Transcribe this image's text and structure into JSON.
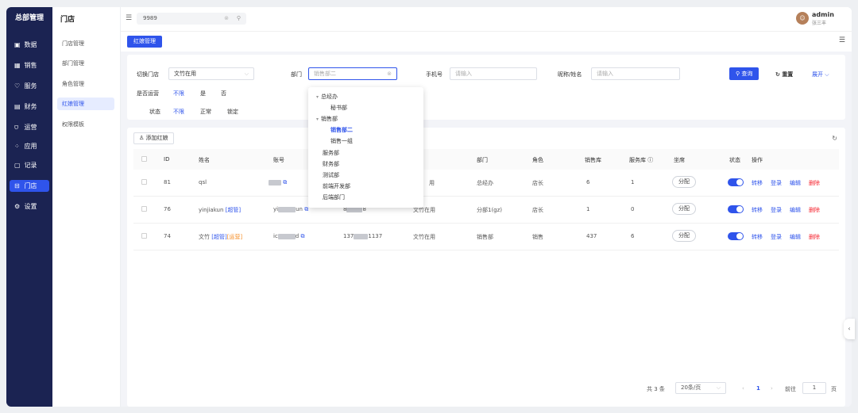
{
  "sidebar": {
    "title": "总部管理",
    "items": [
      {
        "icon": "▣",
        "label": "数据"
      },
      {
        "icon": "▦",
        "label": "销售"
      },
      {
        "icon": "♡",
        "label": "服务"
      },
      {
        "icon": "▤",
        "label": "财务"
      },
      {
        "icon": "⩌",
        "label": "运营"
      },
      {
        "icon": "⁘",
        "label": "应用"
      },
      {
        "icon": "▢",
        "label": "记录"
      },
      {
        "icon": "⊟",
        "label": "门店"
      },
      {
        "icon": "⚙",
        "label": "设置"
      }
    ]
  },
  "submenu": {
    "title": "门店",
    "items": [
      "门店管理",
      "部门管理",
      "角色管理",
      "红娘管理",
      "权限模板"
    ]
  },
  "topbar": {
    "search_value": "9989",
    "user_name": "admin",
    "user_sub": "张三丰"
  },
  "tab": {
    "label": "红娘管理"
  },
  "filter": {
    "store_label": "切换门店",
    "store_value": "文竹在用",
    "dept_label": "部门",
    "dept_placeholder": "销售部二",
    "phone_label": "手机号",
    "phone_placeholder": "请输入",
    "nick_label": "昵称/姓名",
    "nick_placeholder": "请输入",
    "search_btn": "查询",
    "reset_btn": "重置",
    "expand_link": "展开",
    "ops_label": "是否运营",
    "ops_options": [
      "不限",
      "是",
      "否"
    ],
    "status_label": "状态",
    "status_options": [
      "不限",
      "正常",
      "锁定"
    ]
  },
  "dept_tree": [
    {
      "label": "总经办",
      "level": 0,
      "caret": true
    },
    {
      "label": "秘书部",
      "level": 1
    },
    {
      "label": "销售部",
      "level": 0,
      "caret": true
    },
    {
      "label": "销售部二",
      "level": 1,
      "selected": true
    },
    {
      "label": "销售一组",
      "level": 1
    },
    {
      "label": "服务部",
      "level": 0
    },
    {
      "label": "财务部",
      "level": 0
    },
    {
      "label": "测试部",
      "level": 0
    },
    {
      "label": "前端开发部",
      "level": 0
    },
    {
      "label": "后端部门",
      "level": 0
    }
  ],
  "table": {
    "add_btn": "添加红娘",
    "columns": {
      "id": "ID",
      "name": "姓名",
      "account": "账号",
      "dept": "部门",
      "role": "角色",
      "sales": "销售库",
      "service": "服务库",
      "seat": "坐席",
      "status": "状态",
      "ops": "操作"
    },
    "rows": [
      {
        "id": "81",
        "name": "qsl",
        "tag1": "",
        "tag2": "",
        "account_a": "",
        "account_b": "",
        "phone_a": "",
        "phone_b": "",
        "store": "用",
        "dept": "总经办",
        "role": "店长",
        "sales": "6",
        "service": "1"
      },
      {
        "id": "76",
        "name": "yinjiakun",
        "tag1": "[超管]",
        "tag2": "",
        "account_a": "yi",
        "account_b": "un",
        "phone_a": "8",
        "phone_b": "8",
        "store": "文竹在用",
        "dept": "分部1(gz)",
        "role": "店长",
        "sales": "1",
        "service": "0"
      },
      {
        "id": "74",
        "name": "文竹",
        "tag1": "[超管]",
        "tag2": "[运营]",
        "account_a": "ic",
        "account_b": "d",
        "phone_a": "137",
        "phone_b": "1137",
        "store": "文竹在用",
        "dept": "销售部",
        "role": "销售",
        "sales": "437",
        "service": "6"
      }
    ],
    "assign_label": "分配",
    "action_labels": [
      "转移",
      "登录",
      "编辑",
      "删除"
    ]
  },
  "pagination": {
    "total": "共 3 条",
    "page_size": "20条/页",
    "current": "1",
    "goto_label": "前往",
    "goto_value": "1",
    "page_suffix": "页"
  },
  "colors": {
    "primary": "#2f54eb",
    "sidebar": "#1b2352",
    "danger": "#f5222d",
    "tag_orange": "#f58a1f"
  }
}
